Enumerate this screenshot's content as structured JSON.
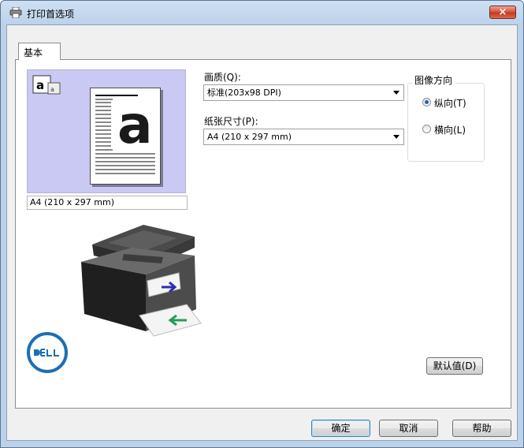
{
  "window": {
    "title": "打印首选项",
    "close_label": "×"
  },
  "tabs": [
    {
      "label": "基本",
      "selected": true
    }
  ],
  "preview": {
    "paper_size_display": "A4 (210 x 297 mm)"
  },
  "quality": {
    "label": "画质(Q):",
    "value": "标准(203x98 DPI)"
  },
  "paper_size": {
    "label": "纸张尺寸(P):",
    "value": "A4 (210 x 297 mm)"
  },
  "orientation": {
    "title": "图像方向",
    "options": [
      {
        "label": "纵向(T)",
        "selected": true
      },
      {
        "label": "横向(L)",
        "selected": false
      }
    ]
  },
  "buttons": {
    "defaults": "默认值(D)",
    "ok": "确定",
    "cancel": "取消",
    "help": "帮助"
  },
  "colors": {
    "accent": "#2a5fb0",
    "preview_background": "#c9c9f3",
    "close_button": "#c43a22"
  }
}
